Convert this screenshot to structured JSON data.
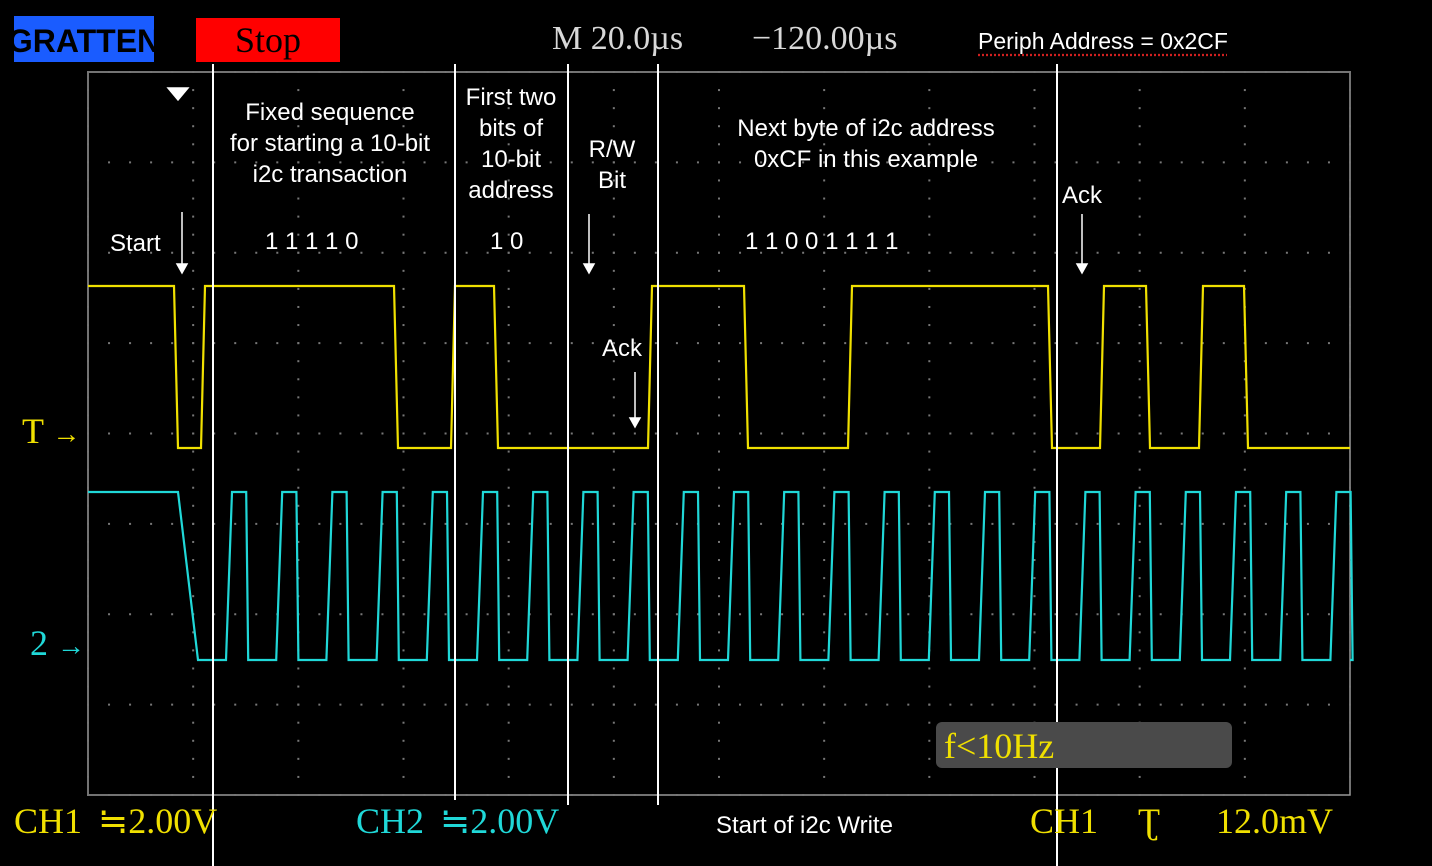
{
  "header": {
    "brand": "GRATTEN",
    "stop_label": "Stop",
    "timebase": "M  20.0µs",
    "trigger_pos": "−120.00µs",
    "periph_address": "Periph Address = 0x2CF"
  },
  "annotations": {
    "fixed_sequence": [
      "Fixed sequence",
      "for starting a 10-bit",
      "i2c transaction"
    ],
    "fixed_bits": "1  1  1  1  0",
    "first_two": [
      "First two",
      "bits of",
      "10-bit",
      "address"
    ],
    "first_two_bits": "1  0",
    "rw_bit": [
      "R/W",
      "Bit"
    ],
    "next_byte": [
      "Next byte of i2c address",
      "0xCF in this example"
    ],
    "next_byte_bits": "1  1  0  0  1  1  1  1",
    "start": "Start",
    "ack1": "Ack",
    "ack2": "Ack",
    "start_write": "Start of i2c Write"
  },
  "channels": {
    "ch1_marker": "T",
    "ch2_marker": "2",
    "ch1_label": "CH1",
    "ch1_scale": "≒2.00V",
    "ch2_label": "CH2",
    "ch2_scale": "≒2.00V",
    "trig_label": "CH1",
    "trig_slope": "Ʈ",
    "trig_level": "12.0mV"
  },
  "frequency": "f<10Hz",
  "colors": {
    "ch1": "#f0e000",
    "ch2": "#20d8d8",
    "stop": "#ff0000"
  }
}
